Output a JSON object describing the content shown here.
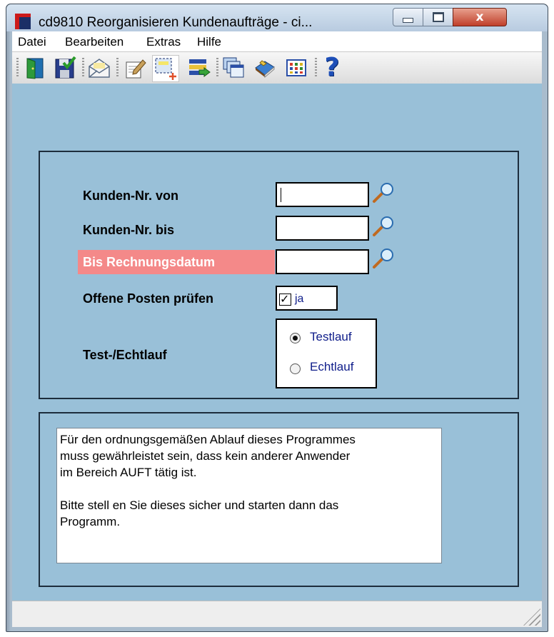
{
  "window": {
    "title": "cd9810 Reorganisieren Kundenaufträge - ci...",
    "buttons": {
      "minimize": "minimize",
      "maximize": "maximize",
      "close": "x"
    }
  },
  "menu": [
    "Datei",
    "Bearbeiten",
    "Extras",
    "Hilfe"
  ],
  "toolbar": {
    "icons": [
      "exit-door-icon",
      "save-icon",
      "mail-icon",
      "edit-document-icon",
      "new-selection-icon",
      "import-list-icon",
      "windows-icon",
      "book-icon",
      "grid-view-icon",
      "help-icon"
    ],
    "help_glyph": "?"
  },
  "form": {
    "kunden_von": {
      "label": "Kunden-Nr. von",
      "value": ""
    },
    "kunden_bis": {
      "label": "Kunden-Nr. bis",
      "value": ""
    },
    "rechnungsdatum": {
      "label": "Bis Rechnungsdatum",
      "value": "",
      "required_color": "#f48989"
    },
    "offene_posten": {
      "label": "Offene Posten prüfen",
      "checkbox_label": "ja",
      "checked": true,
      "check_glyph": "✓"
    },
    "lauf": {
      "label": "Test-/Echtlauf",
      "options": [
        "Testlauf",
        "Echtlauf"
      ],
      "selected": "Testlauf"
    }
  },
  "info": {
    "para1": [
      "Für den ordnungsgemäßen Ablauf dieses Programmes",
      "muss gewährleistet sein, dass kein anderer Anwender",
      "im Bereich AUFT tätig ist."
    ],
    "para2": [
      "Bitte stell en Sie dieses sicher und starten dann das",
      "Programm."
    ]
  },
  "colors": {
    "client_bg": "#99c0d8",
    "accent_text": "#0f1d8a",
    "required_label": "#f48989"
  }
}
